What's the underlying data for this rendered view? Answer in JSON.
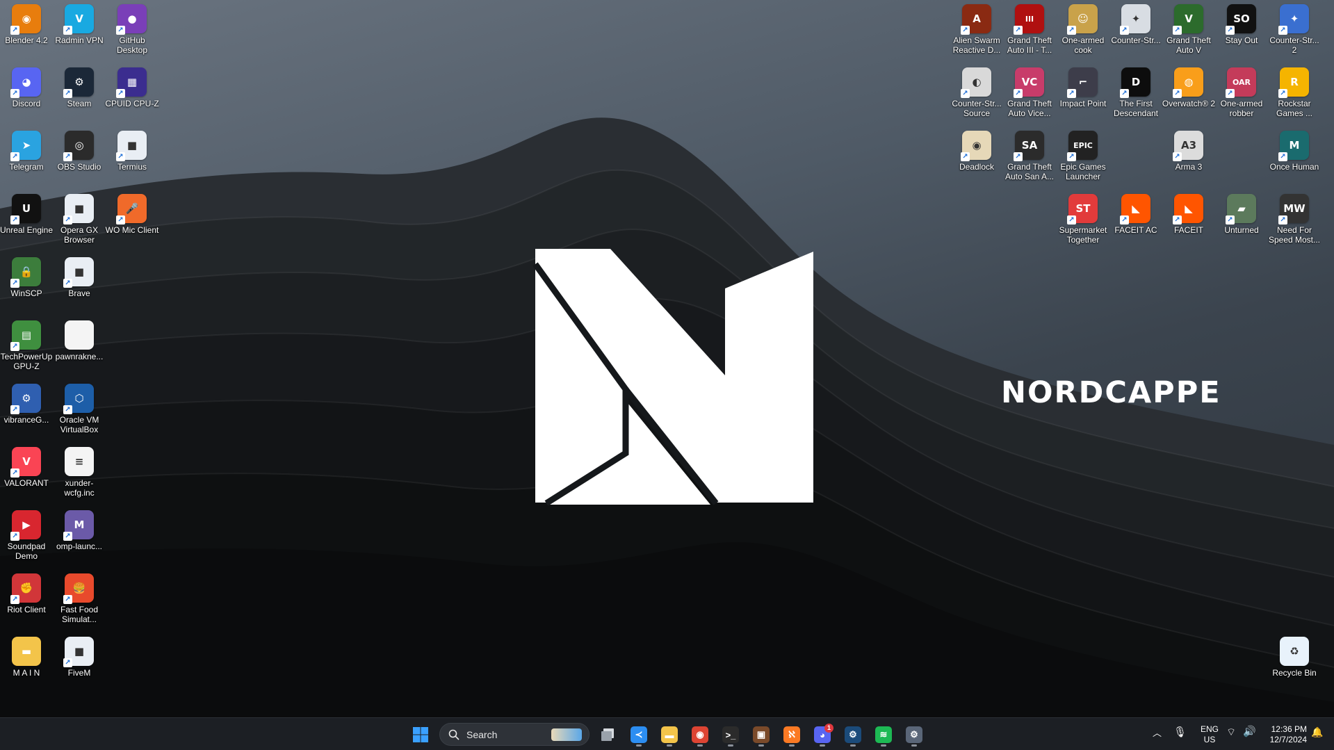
{
  "desktop": {
    "brand_text": "NORDCAPPE",
    "left_icons": [
      {
        "label": "Blender 4.2",
        "icon": "blender-icon",
        "color": "#e87d0d",
        "glyph": "◉"
      },
      {
        "label": "Radmin VPN",
        "icon": "radmin-vpn-icon",
        "color": "#19a9e1",
        "glyph": "V"
      },
      {
        "label": "GitHub Desktop",
        "icon": "github-desktop-icon",
        "color": "#7a3fb8",
        "glyph": "●"
      },
      {
        "label": "Discord",
        "icon": "discord-icon",
        "color": "#5865f2",
        "glyph": "◕"
      },
      {
        "label": "Steam",
        "icon": "steam-icon",
        "color": "#1b2838",
        "glyph": "⚙"
      },
      {
        "label": "CPUID CPU-Z",
        "icon": "cpu-z-icon",
        "color": "#3b2d8f",
        "glyph": "▦"
      },
      {
        "label": "Telegram",
        "icon": "telegram-icon",
        "color": "#2aa3e0",
        "glyph": "➤"
      },
      {
        "label": "OBS Studio",
        "icon": "obs-studio-icon",
        "color": "#2b2b2b",
        "glyph": "◎"
      },
      {
        "label": "Termius",
        "icon": "termius-icon",
        "color": "#e9eef4",
        "glyph": "■"
      },
      {
        "label": "Unreal Engine",
        "icon": "unreal-engine-icon",
        "color": "#111111",
        "glyph": "U"
      },
      {
        "label": "Opera GX Browser",
        "icon": "opera-gx-icon",
        "color": "#e9eef4",
        "glyph": "■"
      },
      {
        "label": "WO Mic Client",
        "icon": "wo-mic-icon",
        "color": "#f06a2a",
        "glyph": "🎤"
      },
      {
        "label": "WinSCP",
        "icon": "winscp-icon",
        "color": "#3c7d3c",
        "glyph": "🔒"
      },
      {
        "label": "Brave",
        "icon": "brave-icon",
        "color": "#e9eef4",
        "glyph": "■"
      },
      {
        "label": "TechPowerUp GPU-Z",
        "icon": "gpu-z-icon",
        "color": "#3f8f3f",
        "glyph": "▤"
      },
      {
        "label": "pawnrakne...",
        "icon": "file-icon",
        "color": "#f4f4f4",
        "glyph": ""
      },
      {
        "label": "vibranceG...",
        "icon": "vibrance-gui-icon",
        "color": "#2f5fb0",
        "glyph": "⚙"
      },
      {
        "label": "Oracle VM VirtualBox",
        "icon": "virtualbox-icon",
        "color": "#1d5ea8",
        "glyph": "⬡"
      },
      {
        "label": "VALORANT",
        "icon": "valorant-icon",
        "color": "#fa4454",
        "glyph": "V"
      },
      {
        "label": "xunder-wcfg.inc",
        "icon": "text-file-icon",
        "color": "#f4f4f4",
        "glyph": "≡"
      },
      {
        "label": "Soundpad Demo",
        "icon": "soundpad-icon",
        "color": "#d8262f",
        "glyph": "▶"
      },
      {
        "label": "omp-launc...",
        "icon": "omp-launcher-icon",
        "color": "#6b5aa8",
        "glyph": "M"
      },
      {
        "label": "Riot Client",
        "icon": "riot-client-icon",
        "color": "#d13639",
        "glyph": "✊"
      },
      {
        "label": "Fast Food Simulat...",
        "icon": "fast-food-simulator-icon",
        "color": "#e84a2c",
        "glyph": "🍔"
      },
      {
        "label": "M A I N",
        "icon": "folder-icon",
        "color": "#f3c44a",
        "glyph": "▬"
      },
      {
        "label": "FiveM",
        "icon": "fivem-icon",
        "color": "#e9eef4",
        "glyph": "■"
      }
    ],
    "right_icons": [
      {
        "label": "Alien Swarm Reactive D...",
        "icon": "alien-swarm-icon",
        "color": "#8a2a12",
        "glyph": "A"
      },
      {
        "label": "Grand Theft Auto III - T...",
        "icon": "gta-iii-icon",
        "color": "#b01010",
        "glyph": "III"
      },
      {
        "label": "One-armed cook",
        "icon": "one-armed-cook-icon",
        "color": "#c9a24a",
        "glyph": "☺"
      },
      {
        "label": "Counter-Str...",
        "icon": "counter-strike-icon",
        "color": "#d8dde3",
        "glyph": "✦"
      },
      {
        "label": "Grand Theft Auto V",
        "icon": "gta-v-icon",
        "color": "#2c6b2c",
        "glyph": "V"
      },
      {
        "label": "Stay Out",
        "icon": "stay-out-icon",
        "color": "#111111",
        "glyph": "SO"
      },
      {
        "label": "Counter-Str... 2",
        "icon": "cs2-icon",
        "color": "#3a6fd0",
        "glyph": "✦"
      },
      {
        "label": "Counter-Str... Source",
        "icon": "cs-source-icon",
        "color": "#d9d9d9",
        "glyph": "◐"
      },
      {
        "label": "Grand Theft Auto Vice...",
        "icon": "gta-vice-city-icon",
        "color": "#c83c6a",
        "glyph": "VC"
      },
      {
        "label": "Impact Point",
        "icon": "impact-point-icon",
        "color": "#3d3d4a",
        "glyph": "⌐"
      },
      {
        "label": "The First Descendant",
        "icon": "first-descendant-icon",
        "color": "#0d0d0d",
        "glyph": "D"
      },
      {
        "label": "Overwatch® 2",
        "icon": "overwatch-icon",
        "color": "#f99e1a",
        "glyph": "◍"
      },
      {
        "label": "One-armed robber",
        "icon": "one-armed-robber-icon",
        "color": "#c43b5a",
        "glyph": "OAR"
      },
      {
        "label": "Rockstar Games ...",
        "icon": "rockstar-icon",
        "color": "#f5b400",
        "glyph": "R"
      },
      {
        "label": "Deadlock",
        "icon": "deadlock-icon",
        "color": "#e6d8b8",
        "glyph": "◉"
      },
      {
        "label": "Grand Theft Auto San A...",
        "icon": "gta-san-andreas-icon",
        "color": "#2b2b2b",
        "glyph": "SA"
      },
      {
        "label": "Epic Games Launcher",
        "icon": "epic-games-icon",
        "color": "#222222",
        "glyph": "EPIC"
      },
      {
        "label": "",
        "icon": "",
        "color": "",
        "glyph": ""
      },
      {
        "label": "Arma 3",
        "icon": "arma-3-icon",
        "color": "#dcdcdc",
        "glyph": "A3"
      },
      {
        "label": "",
        "icon": "",
        "color": "",
        "glyph": ""
      },
      {
        "label": "Once Human",
        "icon": "once-human-icon",
        "color": "#1a6b6e",
        "glyph": "M"
      },
      {
        "label": "Supermarket Together",
        "icon": "supermarket-together-icon",
        "color": "#e23b3b",
        "glyph": "ST"
      },
      {
        "label": "FACEIT AC",
        "icon": "faceit-ac-icon",
        "color": "#ff5500",
        "glyph": "◣"
      },
      {
        "label": "FACEIT",
        "icon": "faceit-icon",
        "color": "#ff5500",
        "glyph": "◣"
      },
      {
        "label": "Unturned",
        "icon": "unturned-icon",
        "color": "#5c7a5c",
        "glyph": "▰"
      },
      {
        "label": "Need For Speed Most...",
        "icon": "nfs-most-wanted-icon",
        "color": "#333333",
        "glyph": "MW"
      },
      {
        "label": "Recycle Bin",
        "icon": "recycle-bin-icon",
        "color": "#e8f2fb",
        "glyph": "♻"
      }
    ]
  },
  "taskbar": {
    "search_label": "Search",
    "pinned": [
      {
        "name": "start-button",
        "icon": "windows-icon"
      },
      {
        "name": "task-view-button",
        "icon": "task-view-icon"
      },
      {
        "name": "vscode-button",
        "icon": "vscode-icon",
        "color": "#2c8ef2",
        "glyph": "≺"
      },
      {
        "name": "file-explorer-button",
        "icon": "folder-icon",
        "color": "#f3c44a",
        "glyph": "▬"
      },
      {
        "name": "chrome-button",
        "icon": "chrome-icon",
        "color": "#dd4433",
        "glyph": "◉"
      },
      {
        "name": "terminal-button",
        "icon": "terminal-icon",
        "color": "#2b2b2b",
        "glyph": ">_"
      },
      {
        "name": "game-app-button",
        "icon": "game-app-icon",
        "color": "#7a4a2a",
        "glyph": "▣"
      },
      {
        "name": "xampp-button",
        "icon": "xampp-icon",
        "color": "#fb7a24",
        "glyph": "ℵ"
      },
      {
        "name": "discord-button",
        "icon": "discord-icon",
        "color": "#5865f2",
        "glyph": "◕",
        "badge": "1"
      },
      {
        "name": "steam-button",
        "icon": "steam-icon",
        "color": "#1b4b7a",
        "glyph": "⚙"
      },
      {
        "name": "spotify-button",
        "icon": "spotify-icon",
        "color": "#1db954",
        "glyph": "≋"
      },
      {
        "name": "settings-button",
        "icon": "gear-icon",
        "color": "#5a6678",
        "glyph": "⚙"
      }
    ],
    "tray": {
      "language_top": "ENG",
      "language_bottom": "US",
      "time": "12:36 PM",
      "date": "12/7/2024"
    }
  }
}
